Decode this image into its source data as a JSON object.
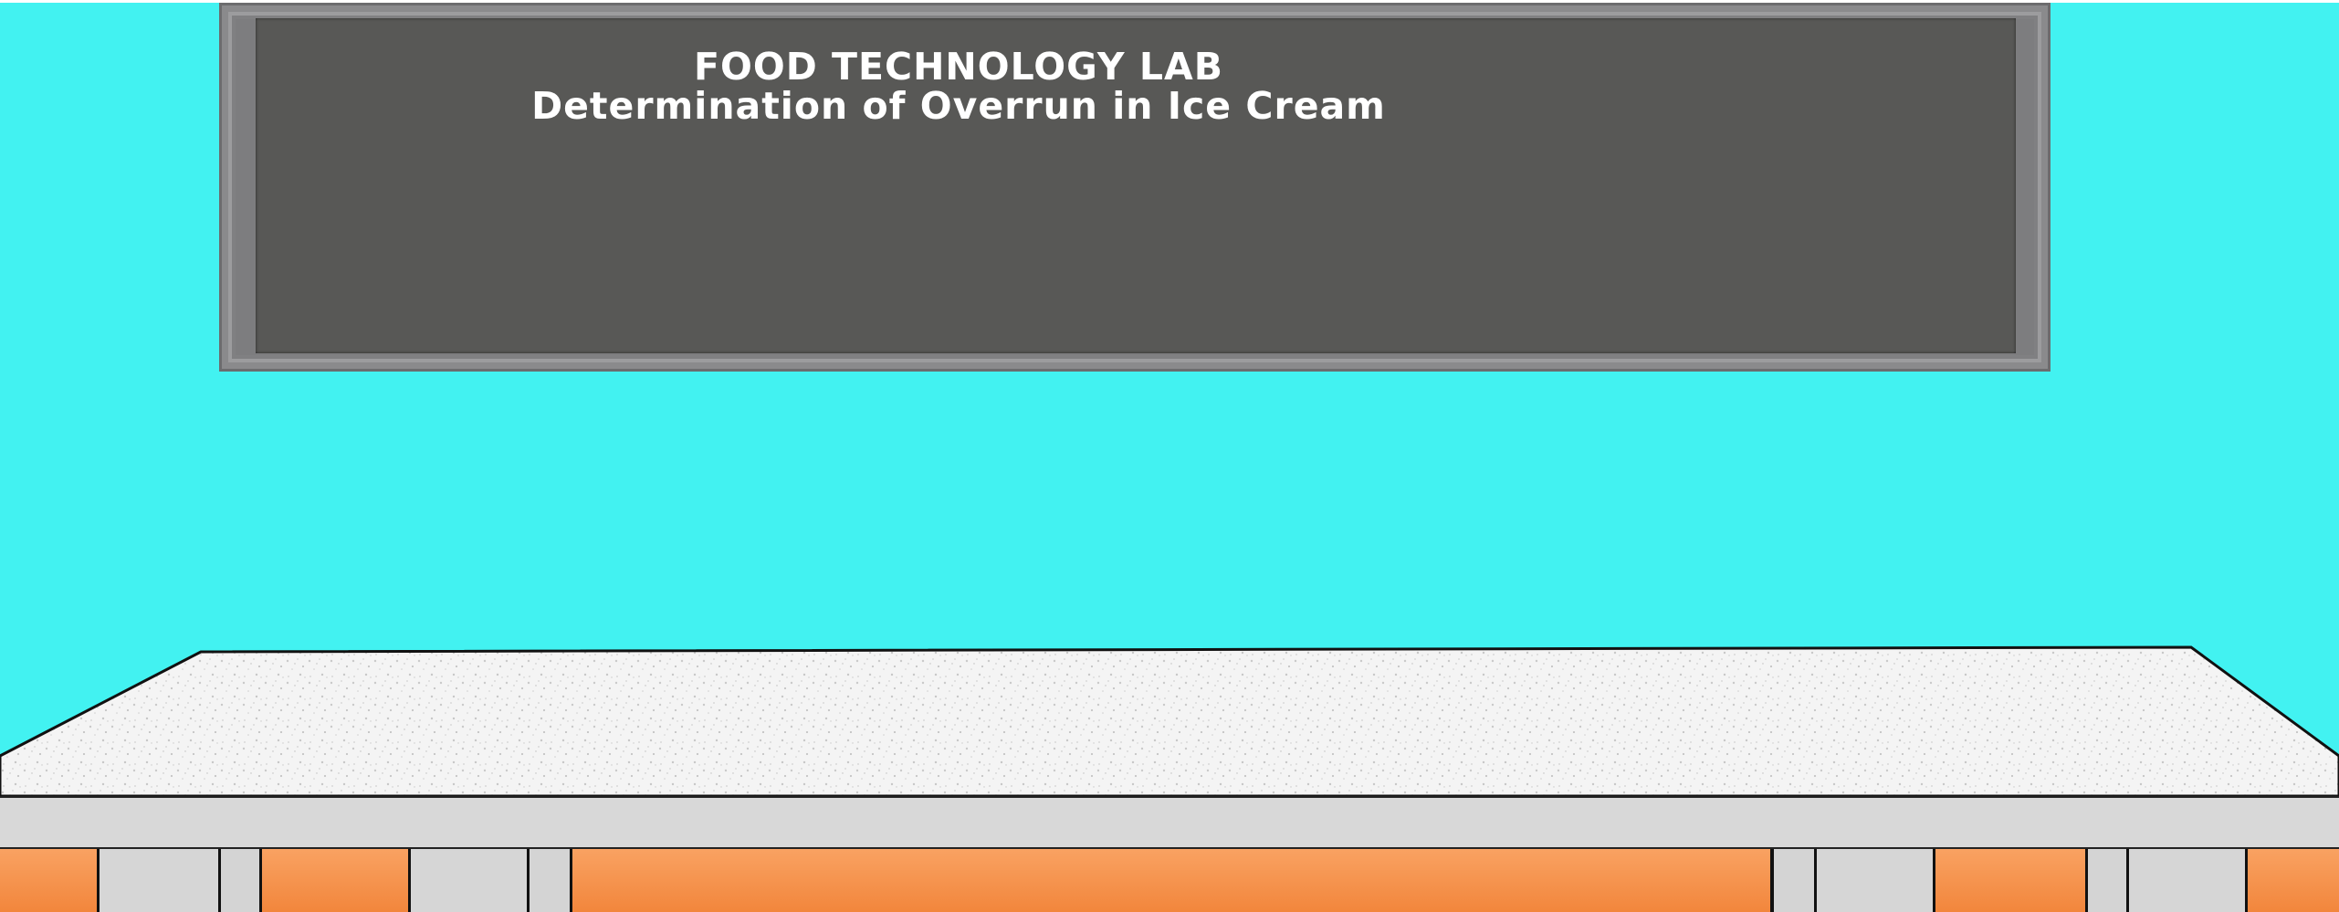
{
  "board": {
    "title": "FOOD TECHNOLOGY LAB",
    "subtitle": "Determination of Overrun in Ice Cream"
  },
  "colors": {
    "wall": "#42f2f1",
    "board_frame": "#7d7d7f",
    "board_surface": "#585856",
    "table_top": "#f2f2f2",
    "table_apron": "#d8d8d8",
    "drawer": "#f2863c"
  }
}
